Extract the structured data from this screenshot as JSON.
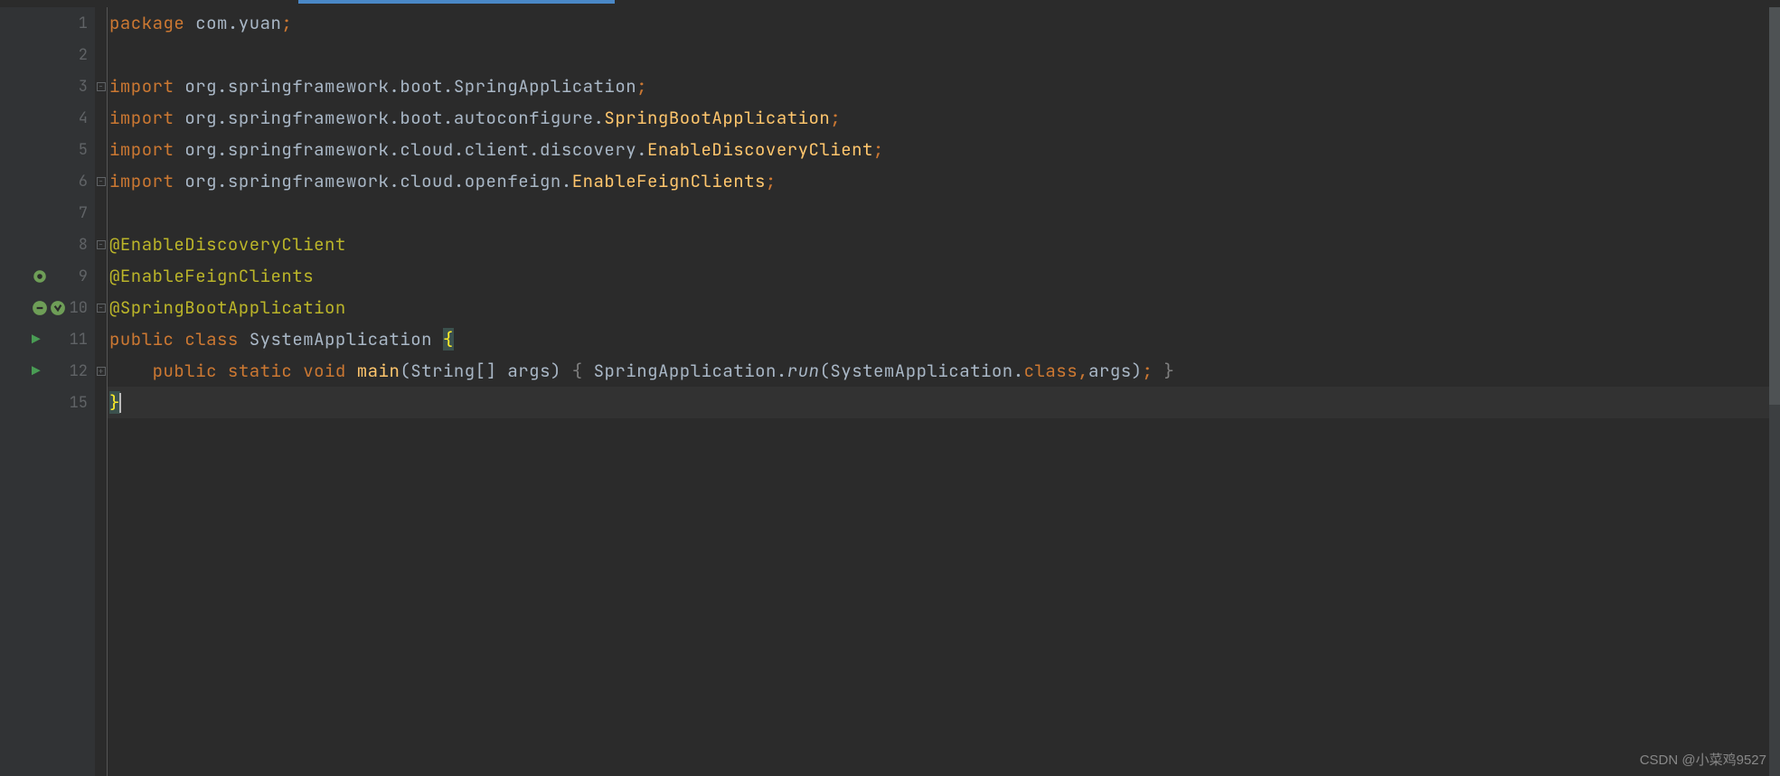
{
  "lines": {
    "l1_num": "1",
    "l2_num": "2",
    "l3_num": "3",
    "l4_num": "4",
    "l5_num": "5",
    "l6_num": "6",
    "l7_num": "7",
    "l8_num": "8",
    "l9_num": "9",
    "l10_num": "10",
    "l11_num": "11",
    "l12_num": "12",
    "l15_num": "15"
  },
  "code": {
    "package_kw": "package ",
    "package_name": "com.yuan",
    "semi": ";",
    "import_kw": "import ",
    "import3": "org.springframework.boot.SpringApplication",
    "import4_pkg": "org.springframework.boot.autoconfigure.",
    "import4_cls": "SpringBootApplication",
    "import5_pkg": "org.springframework.cloud.client.discovery.",
    "import5_cls": "EnableDiscoveryClient",
    "import6_pkg": "org.springframework.cloud.openfeign.",
    "import6_cls": "EnableFeignClients",
    "ann1": "@EnableDiscoveryClient",
    "ann2": "@EnableFeignClients",
    "ann3": "@SpringBootApplication",
    "public_kw": "public ",
    "class_kw": "class ",
    "class_name": "SystemApplication ",
    "brace_open": "{",
    "indent2": "    ",
    "static_kw": "static ",
    "void_kw": "void ",
    "main_name": "main",
    "main_params_open": "(",
    "main_params": "String[] args",
    "main_params_close": ") ",
    "main_brace_open": "{ ",
    "spring_app": "SpringApplication.",
    "run_method": "run",
    "run_open": "(",
    "run_arg_cls": "SystemApplication.",
    "class_lit": "class",
    "comma": ",",
    "args_param": "args",
    "run_close": ")",
    "main_brace_close": " }",
    "brace_close": "}"
  },
  "watermark": "CSDN @小菜鸡9527"
}
